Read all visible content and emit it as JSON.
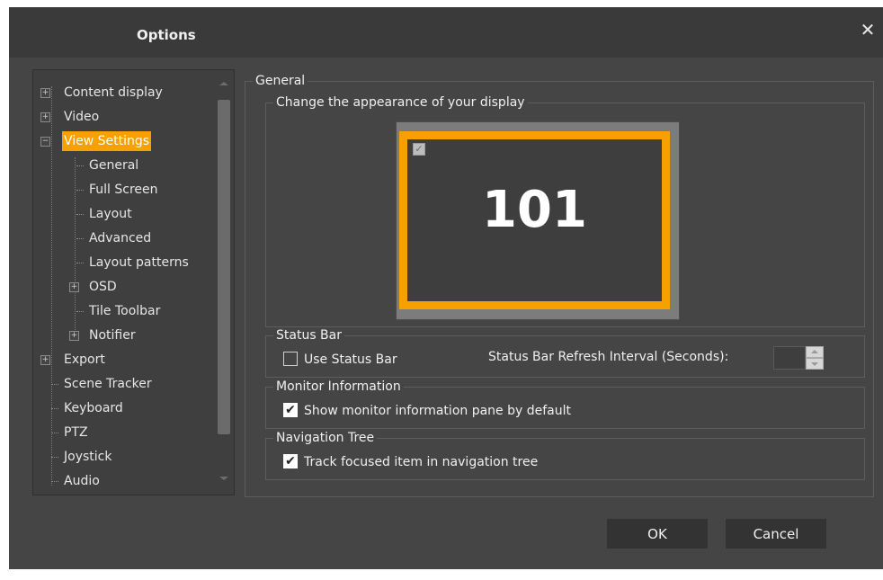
{
  "dialog": {
    "title": "Options",
    "close_symbol": "✕"
  },
  "tree": {
    "items": [
      {
        "label": "Content display",
        "expander": "+"
      },
      {
        "label": "Video",
        "expander": "+"
      },
      {
        "label": "View Settings",
        "expander": "−"
      },
      {
        "label": "General"
      },
      {
        "label": "Full Screen"
      },
      {
        "label": "Layout"
      },
      {
        "label": "Advanced"
      },
      {
        "label": "Layout patterns"
      },
      {
        "label": "OSD",
        "expander": "+"
      },
      {
        "label": "Tile Toolbar"
      },
      {
        "label": "Notifier",
        "expander": "+"
      },
      {
        "label": "Export",
        "expander": "+"
      },
      {
        "label": "Scene Tracker"
      },
      {
        "label": "Keyboard"
      },
      {
        "label": "PTZ"
      },
      {
        "label": "Joystick"
      },
      {
        "label": "Audio"
      }
    ],
    "selected": "View Settings"
  },
  "general": {
    "legend": "General",
    "appearance": {
      "legend": "Change the appearance of your display",
      "preview_number": "101",
      "preview_check": "✓"
    },
    "status_bar": {
      "legend": "Status Bar",
      "use_label": "Use Status Bar",
      "use_checked": false,
      "refresh_label": "Status Bar Refresh Interval (Seconds):",
      "refresh_value": ""
    },
    "monitor_info": {
      "legend": "Monitor Information",
      "show_label": "Show monitor information pane by default",
      "show_checked": true
    },
    "nav_tree": {
      "legend": "Navigation Tree",
      "track_label": "Track focused item in navigation tree",
      "track_checked": true
    }
  },
  "buttons": {
    "ok": "OK",
    "cancel": "Cancel"
  },
  "colors": {
    "accent": "#f7a100",
    "dialog_bg": "#454545",
    "titlebar_bg": "#3a3a3a"
  },
  "check_glyph": "✔"
}
